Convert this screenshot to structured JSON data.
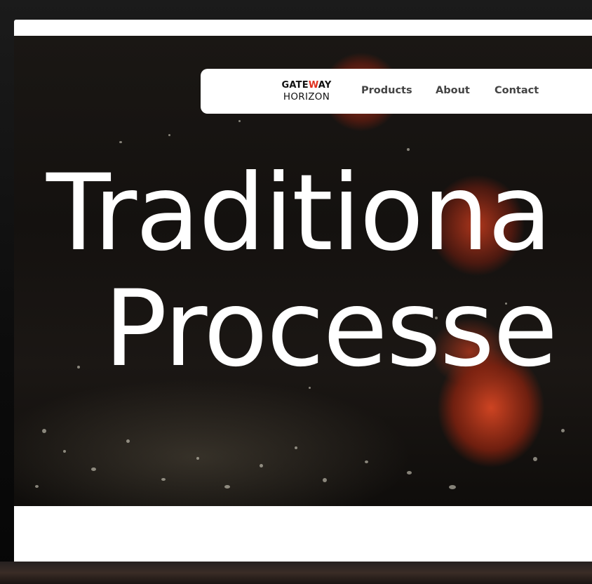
{
  "brand": {
    "name_top_prefix": "GATE",
    "name_top_accent": "W",
    "name_top_suffix": "AY",
    "name_bottom": "HORIZON"
  },
  "nav": {
    "items": [
      {
        "label": "Products"
      },
      {
        "label": "About"
      },
      {
        "label": "Contact"
      }
    ]
  },
  "hero": {
    "headline_line1": "Traditiona",
    "headline_line2": "Processe",
    "background": "falling tomatoes splashing water video"
  },
  "colors": {
    "accent": "#e0301e",
    "nav_bg": "#ffffff",
    "headline": "#ffffff"
  }
}
